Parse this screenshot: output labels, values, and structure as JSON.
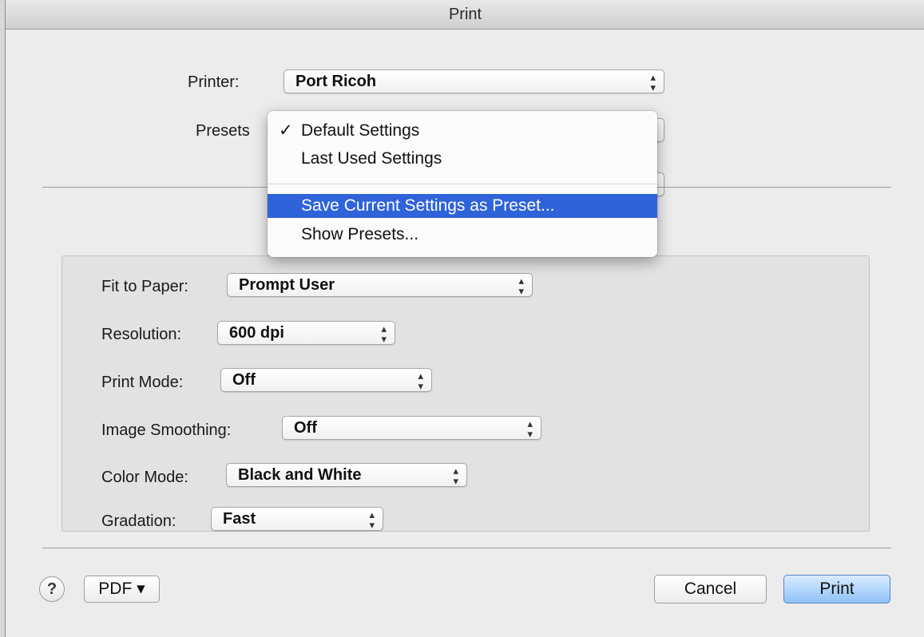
{
  "window": {
    "title": "Print"
  },
  "printer": {
    "label": "Printer:",
    "value": "Port Ricoh"
  },
  "presets": {
    "label": "Presets",
    "menu": {
      "check_mark": "✓",
      "items": [
        {
          "label": "Default Settings",
          "checked": true
        },
        {
          "label": "Last Used Settings"
        },
        {
          "label": "Save Current Settings as Preset...",
          "highlighted": true
        },
        {
          "label": "Show Presets..."
        }
      ]
    }
  },
  "settings": [
    {
      "label": "Fit to Paper:",
      "value": "Prompt User"
    },
    {
      "label": "Resolution:",
      "value": "600 dpi"
    },
    {
      "label": "Print Mode:",
      "value": "Off"
    },
    {
      "label": "Image Smoothing:",
      "value": "Off"
    },
    {
      "label": "Color Mode:",
      "value": "Black and White"
    },
    {
      "label": "Gradation:",
      "value": "Fast"
    }
  ],
  "footer": {
    "help_label": "?",
    "pdf_label": "PDF ▾",
    "cancel_label": "Cancel",
    "print_label": "Print"
  },
  "icons": {
    "popup_arrows_up": "▴",
    "popup_arrows_down": "▾"
  },
  "colors": {
    "highlight": "#2f63d9",
    "default_button": "#8fc2f6"
  }
}
